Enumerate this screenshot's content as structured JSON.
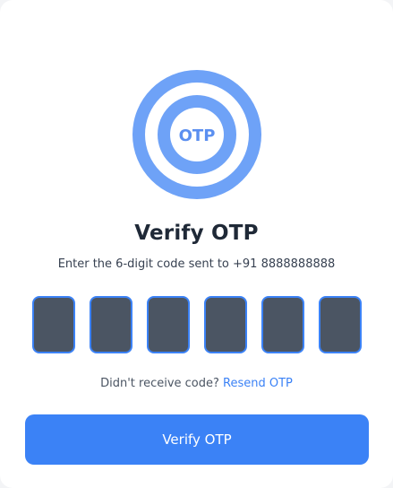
{
  "logo": {
    "text": "OTP",
    "ring_color": "#6ea2f7",
    "text_color": "#5b8ff0"
  },
  "title": "Verify OTP",
  "subtitle": "Enter the 6-digit code sent to +91 8888888888",
  "otp": {
    "digits": [
      "",
      "",
      "",
      "",
      "",
      ""
    ],
    "box_color": "#4b5563",
    "border_color": "#3b82f6"
  },
  "resend": {
    "prompt": "Didn't receive code?",
    "link_label": "Resend OTP"
  },
  "verify_button": {
    "label": "Verify OTP",
    "color": "#3b82f6"
  }
}
